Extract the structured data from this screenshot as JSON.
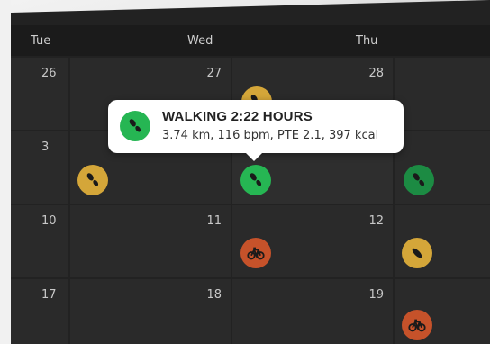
{
  "header": {
    "days": [
      "Tue",
      "Wed",
      "Thu"
    ]
  },
  "weeks": [
    {
      "days": [
        "26",
        "27",
        "28"
      ]
    },
    {
      "days": [
        "3",
        "",
        ""
      ]
    },
    {
      "days": [
        "10",
        "11",
        "12"
      ]
    },
    {
      "days": [
        "17",
        "18",
        "19"
      ]
    }
  ],
  "tooltip": {
    "title": "WALKING 2:22 HOURS",
    "detail": "3.74 km, 116 bpm, PTE 2.1, 397 kcal",
    "activity_icon": "walking-shoe-icon"
  },
  "activities": [
    {
      "day": "27",
      "type": "walking",
      "color": "#d4a639",
      "icon": "walking-shoe-icon"
    },
    {
      "day": "3",
      "type": "walking",
      "color": "#d4a639",
      "icon": "walking-shoe-icon"
    },
    {
      "day": "4",
      "type": "walking",
      "color": "#26b653",
      "icon": "walking-shoe-icon"
    },
    {
      "day": "5",
      "type": "walking",
      "color": "#1c8b43",
      "icon": "walking-shoe-icon"
    },
    {
      "day": "11",
      "type": "cycling",
      "color": "#c6522a",
      "icon": "bicycle-icon"
    },
    {
      "day": "12",
      "type": "walking",
      "color": "#d4a639",
      "icon": "walking-shoe-icon"
    },
    {
      "day": "19",
      "type": "cycling",
      "color": "#c6522a",
      "icon": "bicycle-icon"
    }
  ],
  "colors": {
    "background": "#222222",
    "tooltip": "#ffffff"
  }
}
